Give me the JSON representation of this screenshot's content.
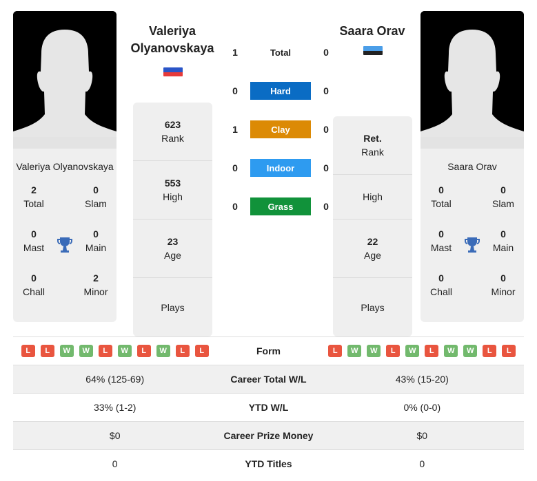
{
  "player1": {
    "name_header": [
      "Valeriya",
      "Olyanovskaya"
    ],
    "name_card": "Valeriya Olyanovskaya",
    "flag_colors": [
      "#2a55c8",
      "#e63a3a"
    ],
    "titles": {
      "total": {
        "value": "2",
        "label": "Total"
      },
      "slam": {
        "value": "0",
        "label": "Slam"
      },
      "mast": {
        "value": "0",
        "label": "Mast"
      },
      "main": {
        "value": "0",
        "label": "Main"
      },
      "chall": {
        "value": "0",
        "label": "Chall"
      },
      "minor": {
        "value": "2",
        "label": "Minor"
      }
    },
    "stats": [
      {
        "value": "623",
        "label": "Rank"
      },
      {
        "value": "553",
        "label": "High"
      },
      {
        "value": "23",
        "label": "Age"
      },
      {
        "value": "",
        "label": "Plays"
      }
    ],
    "form": [
      "L",
      "L",
      "W",
      "W",
      "L",
      "W",
      "L",
      "W",
      "L",
      "L"
    ]
  },
  "player2": {
    "name_header": [
      "Saara Orav"
    ],
    "name_card": "Saara Orav",
    "flag_colors": [
      "#4b9ee8",
      "#222222"
    ],
    "titles": {
      "total": {
        "value": "0",
        "label": "Total"
      },
      "slam": {
        "value": "0",
        "label": "Slam"
      },
      "mast": {
        "value": "0",
        "label": "Mast"
      },
      "main": {
        "value": "0",
        "label": "Main"
      },
      "chall": {
        "value": "0",
        "label": "Chall"
      },
      "minor": {
        "value": "0",
        "label": "Minor"
      }
    },
    "stats": [
      {
        "value": "Ret.",
        "label": "Rank"
      },
      {
        "value": "",
        "label": "High"
      },
      {
        "value": "22",
        "label": "Age"
      },
      {
        "value": "",
        "label": "Plays"
      }
    ],
    "form": [
      "L",
      "W",
      "W",
      "L",
      "W",
      "L",
      "W",
      "W",
      "L",
      "L"
    ]
  },
  "h2h": [
    {
      "label": "Total",
      "p1": "1",
      "p2": "0",
      "color": null
    },
    {
      "label": "Hard",
      "p1": "0",
      "p2": "0",
      "color": "#0a6cc4"
    },
    {
      "label": "Clay",
      "p1": "1",
      "p2": "0",
      "color": "#dc8a05"
    },
    {
      "label": "Indoor",
      "p1": "0",
      "p2": "0",
      "color": "#2e9bf0"
    },
    {
      "label": "Grass",
      "p1": "0",
      "p2": "0",
      "color": "#11923a"
    }
  ],
  "comparison": {
    "form_label": "Form",
    "rows": [
      {
        "label": "Career Total W/L",
        "p1": "64% (125-69)",
        "p2": "43% (15-20)"
      },
      {
        "label": "YTD W/L",
        "p1": "33% (1-2)",
        "p2": "0% (0-0)"
      },
      {
        "label": "Career Prize Money",
        "p1": "$0",
        "p2": "$0"
      },
      {
        "label": "YTD Titles",
        "p1": "0",
        "p2": "0"
      }
    ]
  },
  "icons": {
    "trophy": "trophy-icon",
    "silhouette": "player-silhouette"
  }
}
